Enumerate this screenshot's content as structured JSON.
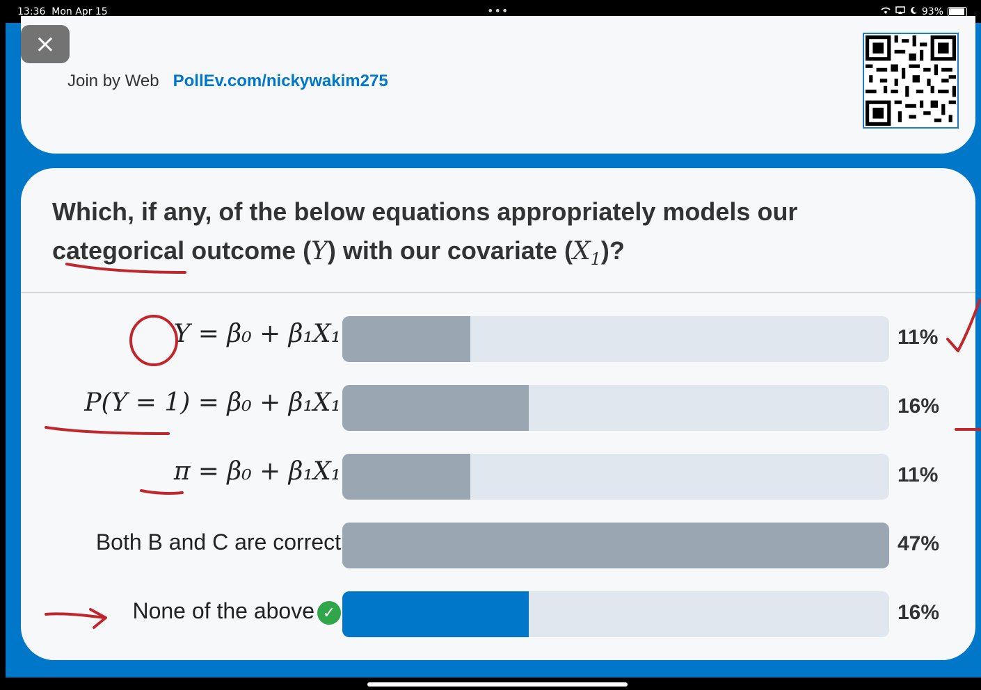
{
  "status_bar": {
    "time": "13:36",
    "date": "Mon Apr 15",
    "battery": "93%"
  },
  "header": {
    "close_label": "×",
    "join_text": "Join by Web",
    "join_url": "PollEv.com/nickywakim275"
  },
  "poll": {
    "question_part1": "Which, if any, of the below equations appropriately models our",
    "question_word_categorical": "categorical",
    "question_part2": "outcome (",
    "question_var_y": "Y",
    "question_part3": ") with our covariate (",
    "question_var_x": "X",
    "question_var_x_sub": "1",
    "question_part4": ")?",
    "options": [
      {
        "label": "Y = β₀ + β₁X₁",
        "percent_text": "11%",
        "percent": 11,
        "correct": false
      },
      {
        "label": "P(Y = 1) = β₀ + β₁X₁",
        "percent_text": "16%",
        "percent": 16,
        "correct": false
      },
      {
        "label": "π = β₀ + β₁X₁",
        "percent_text": "11%",
        "percent": 11,
        "correct": false
      },
      {
        "label": "Both B and C are correct",
        "percent_text": "47%",
        "percent": 47,
        "correct": false
      },
      {
        "label": "None of the above",
        "percent_text": "16%",
        "percent": 16,
        "correct": true
      }
    ],
    "bar_scale_max_percent": 47,
    "colors": {
      "fill": "#9aa7b2",
      "fill_correct": "#0077c8",
      "track": "#e1e7ee",
      "brand": "#0077c8",
      "check": "#2fa64a",
      "annotation": "#c0272d"
    }
  }
}
